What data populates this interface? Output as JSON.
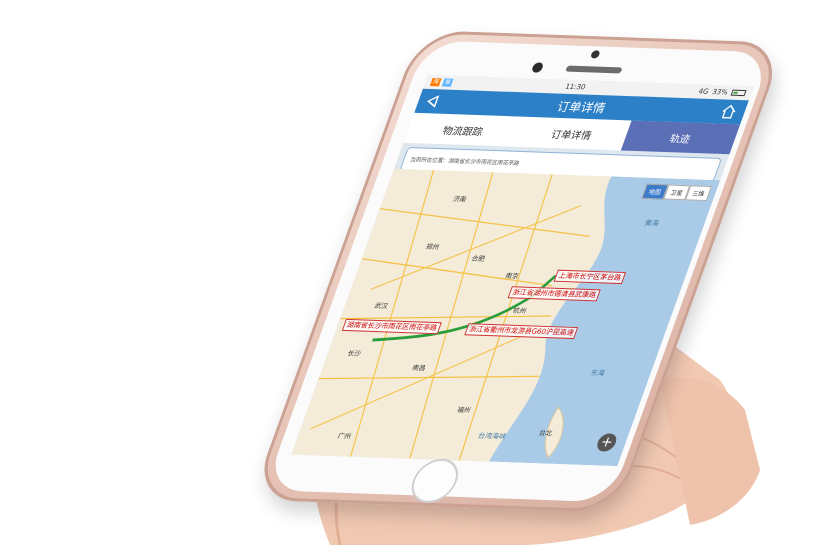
{
  "status_bar": {
    "time": "11:30",
    "notif_a": "淘",
    "notif_b": "⊠",
    "signal": "4G",
    "battery": "33%"
  },
  "app": {
    "title": "订单详情"
  },
  "tabs": [
    {
      "label": "物流跟踪"
    },
    {
      "label": "订单详情"
    },
    {
      "label": "轨迹"
    }
  ],
  "address": "当前所在位置：湖南省长沙市雨花区雨花亭路",
  "map": {
    "type_buttons": [
      "地图",
      "卫星",
      "三维"
    ],
    "route_labels": [
      "上海市长宁区茅台路",
      "浙江省湖州市德清县武康路",
      "湖南省长沙市雨花区雨花亭路",
      "浙江省衢州市龙游县G60沪昆高速"
    ],
    "places": [
      "济南",
      "南京",
      "武汉",
      "长沙",
      "杭州",
      "福州",
      "台北",
      "广州",
      "合肥",
      "郑州",
      "南昌"
    ],
    "seas": [
      "黄海",
      "东海",
      "台湾海峡"
    ],
    "zoom_in": "+"
  },
  "colors": {
    "titlebar": "#2b80c8",
    "track_tab": "#5b6fb7",
    "route": "#2a9d3a",
    "phone_body": "#e9c8bb"
  }
}
